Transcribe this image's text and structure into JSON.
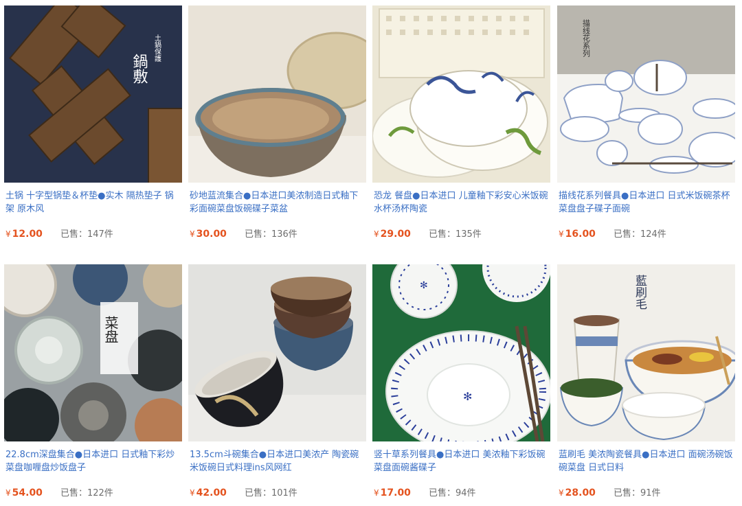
{
  "products": [
    {
      "title": "土锅 十字型锅垫＆杯垫●实木 隔热垫子 锅架 原木风",
      "currency": "¥",
      "price": "12.00",
      "sold_label": "已售：",
      "sold": "147件",
      "image_text": "鍋敷",
      "image_subtext": "土鍋保護"
    },
    {
      "title": "砂地蓝流集合●日本进口美浓制造日式釉下彩面碗菜盘饭碗碟子菜盆",
      "currency": "¥",
      "price": "30.00",
      "sold_label": "已售：",
      "sold": "136件"
    },
    {
      "title": "恐龙 餐盘●日本进口 儿童釉下彩安心米饭碗水杯汤杯陶瓷",
      "currency": "¥",
      "price": "29.00",
      "sold_label": "已售：",
      "sold": "135件"
    },
    {
      "title": "描线花系列餐具●日本进口 日式米饭碗茶杯菜盘盘子碟子面碗",
      "currency": "¥",
      "price": "16.00",
      "sold_label": "已售：",
      "sold": "124件",
      "image_text": "描线花系列"
    },
    {
      "title": "22.8cm深盘集合●日本进口 日式釉下彩炒菜盘咖喱盘炒饭盘子",
      "currency": "¥",
      "price": "54.00",
      "sold_label": "已售：",
      "sold": "122件",
      "image_text": "菜盘"
    },
    {
      "title": "13.5cm斗碗集合●日本进口美浓产 陶瓷碗米饭碗日式料理ins风网红",
      "currency": "¥",
      "price": "42.00",
      "sold_label": "已售：",
      "sold": "101件"
    },
    {
      "title": "竖十草系列餐具●日本进口 美浓釉下彩饭碗菜盘面碗酱碟子",
      "currency": "¥",
      "price": "17.00",
      "sold_label": "已售：",
      "sold": "94件"
    },
    {
      "title": "蓝刷毛 美浓陶瓷餐具●日本进口 面碗汤碗饭碗菜盘 日式日料",
      "currency": "¥",
      "price": "28.00",
      "sold_label": "已售：",
      "sold": "91件",
      "image_text": "藍刷毛"
    }
  ]
}
